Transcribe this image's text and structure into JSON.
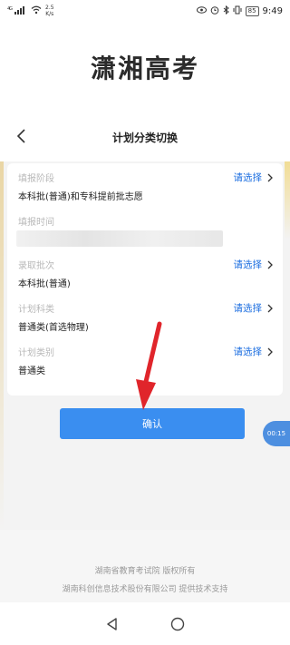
{
  "status_bar": {
    "signal": "⁴ᴳ…",
    "speed_value": "2.5",
    "speed_unit": "K/s",
    "battery": "85",
    "time": "9:49"
  },
  "app": {
    "title": "潇湘高考"
  },
  "nav": {
    "title": "计划分类切换"
  },
  "form": {
    "rows": [
      {
        "label": "填报阶段",
        "value": "本科批(普通)和专科提前批志愿",
        "action": "请选择"
      },
      {
        "label": "填报时间",
        "value": "",
        "action": ""
      },
      {
        "label": "录取批次",
        "value": "本科批(普通)",
        "action": "请选择"
      },
      {
        "label": "计划科类",
        "value": "普通类(首选物理)",
        "action": "请选择"
      },
      {
        "label": "计划类别",
        "value": "普通类",
        "action": "请选择"
      }
    ]
  },
  "confirm": {
    "label": "确认"
  },
  "timer": {
    "text": "00:15"
  },
  "footer": {
    "line1": "湖南省教育考试院 版权所有",
    "line2": "湖南科创信息技术股份有限公司 提供技术支持"
  },
  "colors": {
    "accent": "#1e6fe0",
    "button": "#3a8ef0",
    "arrow": "#e0252b"
  }
}
